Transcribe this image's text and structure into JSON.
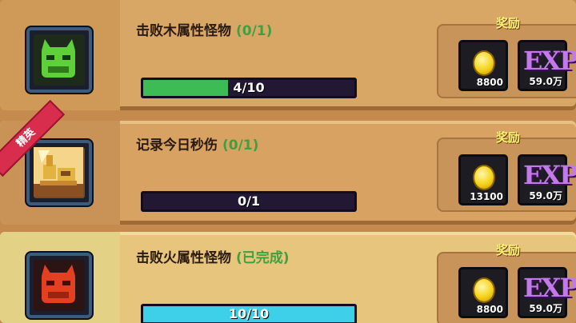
{
  "quests": [
    {
      "title": "击败木属性怪物",
      "status": "(0/1)",
      "progress_text": "4/10",
      "progress_fraction": 0.4,
      "bar_color": "#3dbb55",
      "icon": "green-demon-icon",
      "reward_label": "奖励",
      "coin_amount": "8800",
      "exp_amount": "59.0万"
    },
    {
      "title": "记录今日秒伤",
      "status": "(0/1)",
      "progress_text": "0/1",
      "progress_fraction": 0,
      "bar_color": "#3dbb55",
      "icon": "golden-knight-icon",
      "reward_label": "奖励",
      "coin_amount": "13100",
      "exp_amount": "59.0万",
      "ribbon": "精英"
    },
    {
      "title": "击败火属性怪物",
      "status": "(已完成)",
      "progress_text": "10/10",
      "progress_fraction": 1,
      "bar_color": "#3ed0e8",
      "icon": "red-demon-icon",
      "reward_label": "奖励",
      "coin_amount": "8800",
      "exp_amount": "59.0万"
    }
  ],
  "exp_glyph": "EXP"
}
